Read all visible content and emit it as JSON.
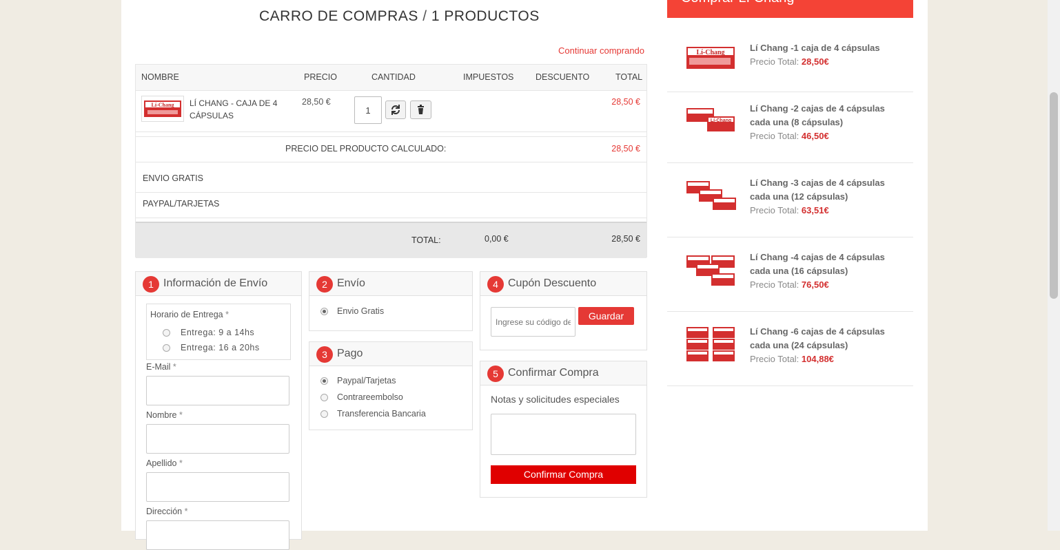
{
  "header": {
    "title": "CARRO DE COMPRAS",
    "separator": "/",
    "count": "1 PRODUCTOS",
    "continue_link": "Continuar comprando"
  },
  "table": {
    "columns": [
      "NOMBRE",
      "PRECIO",
      "CANTIDAD",
      "IMPUESTOS",
      "DESCUENTO",
      "TOTAL"
    ],
    "product": {
      "name": "LÍ CHANG - CAJA DE 4 CÁPSULAS",
      "price": "28,50 €",
      "quantity": "1",
      "total": "28,50 €"
    },
    "calculated_label": "PRECIO DEL PRODUCTO CALCULADO:",
    "calculated_value": "28,50 €",
    "shipping_method": "ENVIO GRATIS",
    "payment_method": "PAYPAL/TARJETAS",
    "total_label": "TOTAL:",
    "total_tax": "0,00 €",
    "total_value": "28,50 €"
  },
  "panels": {
    "info": {
      "number": "1",
      "title": "Información de Envío",
      "schedule_label": "Horario de Entrega",
      "req": "*",
      "schedule_options": [
        "Entrega: 9 a 14hs",
        "Entrega: 16 a 20hs"
      ],
      "fields": [
        "E-Mail",
        "Nombre",
        "Apellido",
        "Dirección"
      ]
    },
    "shipping": {
      "number": "2",
      "title": "Envío",
      "option": "Envio Gratis"
    },
    "payment": {
      "number": "3",
      "title": "Pago",
      "options": [
        "Paypal/Tarjetas",
        "Contrareembolso",
        "Transferencia Bancaria"
      ]
    },
    "coupon": {
      "number": "4",
      "title": "Cupón Descuento",
      "placeholder": "Ingrese su código de cupón",
      "button": "Guardar"
    },
    "confirm": {
      "number": "5",
      "title": "Confirmar Compra",
      "notes_label": "Notas y solicitudes especiales",
      "button": "Confirmar Compra"
    }
  },
  "sidebar": {
    "heading": "Comprar Lí Chang",
    "price_label": "Precio Total:",
    "items": [
      {
        "name": "Lí Chang -1 caja de 4 cápsulas",
        "price": "28,50€"
      },
      {
        "name": "Lí Chang -2 cajas de 4 cápsulas cada una (8 cápsulas)",
        "price": "46,50€"
      },
      {
        "name": "Lí Chang -3 cajas de 4 cápsulas cada una (12 cápsulas)",
        "price": "63,51€"
      },
      {
        "name": "Lí Chang -4 cajas de 4 cápsulas cada una (16 cápsulas)",
        "price": "76,50€"
      },
      {
        "name": "Lí Chang -6 cajas de 4 cápsulas cada una (24 cápsulas)",
        "price": "104,88€"
      }
    ]
  },
  "icons": {
    "refresh": "refresh-icon",
    "delete": "trash-icon"
  },
  "colors": {
    "accent": "#e53935",
    "price": "#d32f2f"
  }
}
